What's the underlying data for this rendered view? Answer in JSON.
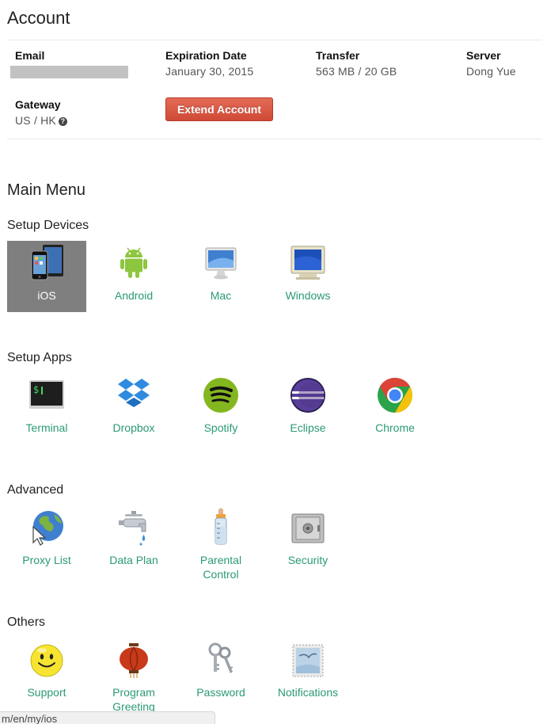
{
  "account": {
    "title": "Account",
    "email_label": "Email",
    "expiration_label": "Expiration Date",
    "expiration_value": "January 30, 2015",
    "transfer_label": "Transfer",
    "transfer_value": "563 MB / 20 GB",
    "server_label": "Server",
    "server_value": "Dong Yue",
    "gateway_label": "Gateway",
    "gateway_value": "US / HK",
    "extend_button": "Extend Account"
  },
  "main_menu": {
    "title": "Main Menu",
    "setup_devices": {
      "title": "Setup Devices",
      "items": [
        {
          "label": "iOS",
          "icon": "ios-devices-icon"
        },
        {
          "label": "Android",
          "icon": "android-icon"
        },
        {
          "label": "Mac",
          "icon": "imac-icon"
        },
        {
          "label": "Windows",
          "icon": "windows-monitor-icon"
        }
      ]
    },
    "setup_apps": {
      "title": "Setup Apps",
      "items": [
        {
          "label": "Terminal",
          "icon": "terminal-icon"
        },
        {
          "label": "Dropbox",
          "icon": "dropbox-icon"
        },
        {
          "label": "Spotify",
          "icon": "spotify-icon"
        },
        {
          "label": "Eclipse",
          "icon": "eclipse-icon"
        },
        {
          "label": "Chrome",
          "icon": "chrome-icon"
        }
      ]
    },
    "advanced": {
      "title": "Advanced",
      "items": [
        {
          "label": "Proxy List",
          "icon": "globe-cursor-icon"
        },
        {
          "label": "Data Plan",
          "icon": "faucet-icon"
        },
        {
          "label": "Parental Control",
          "label_line1": "Parental",
          "label_line2": "Control",
          "icon": "baby-bottle-icon"
        },
        {
          "label": "Security",
          "icon": "safe-icon"
        }
      ]
    },
    "others": {
      "title": "Others",
      "items": [
        {
          "label": "Support",
          "icon": "smiley-icon"
        },
        {
          "label": "Program Greeting",
          "label_line1": "Program",
          "label_line2": "Greeting",
          "icon": "lantern-icon"
        },
        {
          "label": "Password",
          "icon": "keys-icon"
        },
        {
          "label": "Notifications",
          "icon": "stamp-icon"
        }
      ]
    }
  },
  "status_bar": {
    "url": "m/en/my/ios"
  },
  "colors": {
    "link": "#2a9a73",
    "active_tile": "#7f7f7f",
    "button": "#d9533f"
  }
}
